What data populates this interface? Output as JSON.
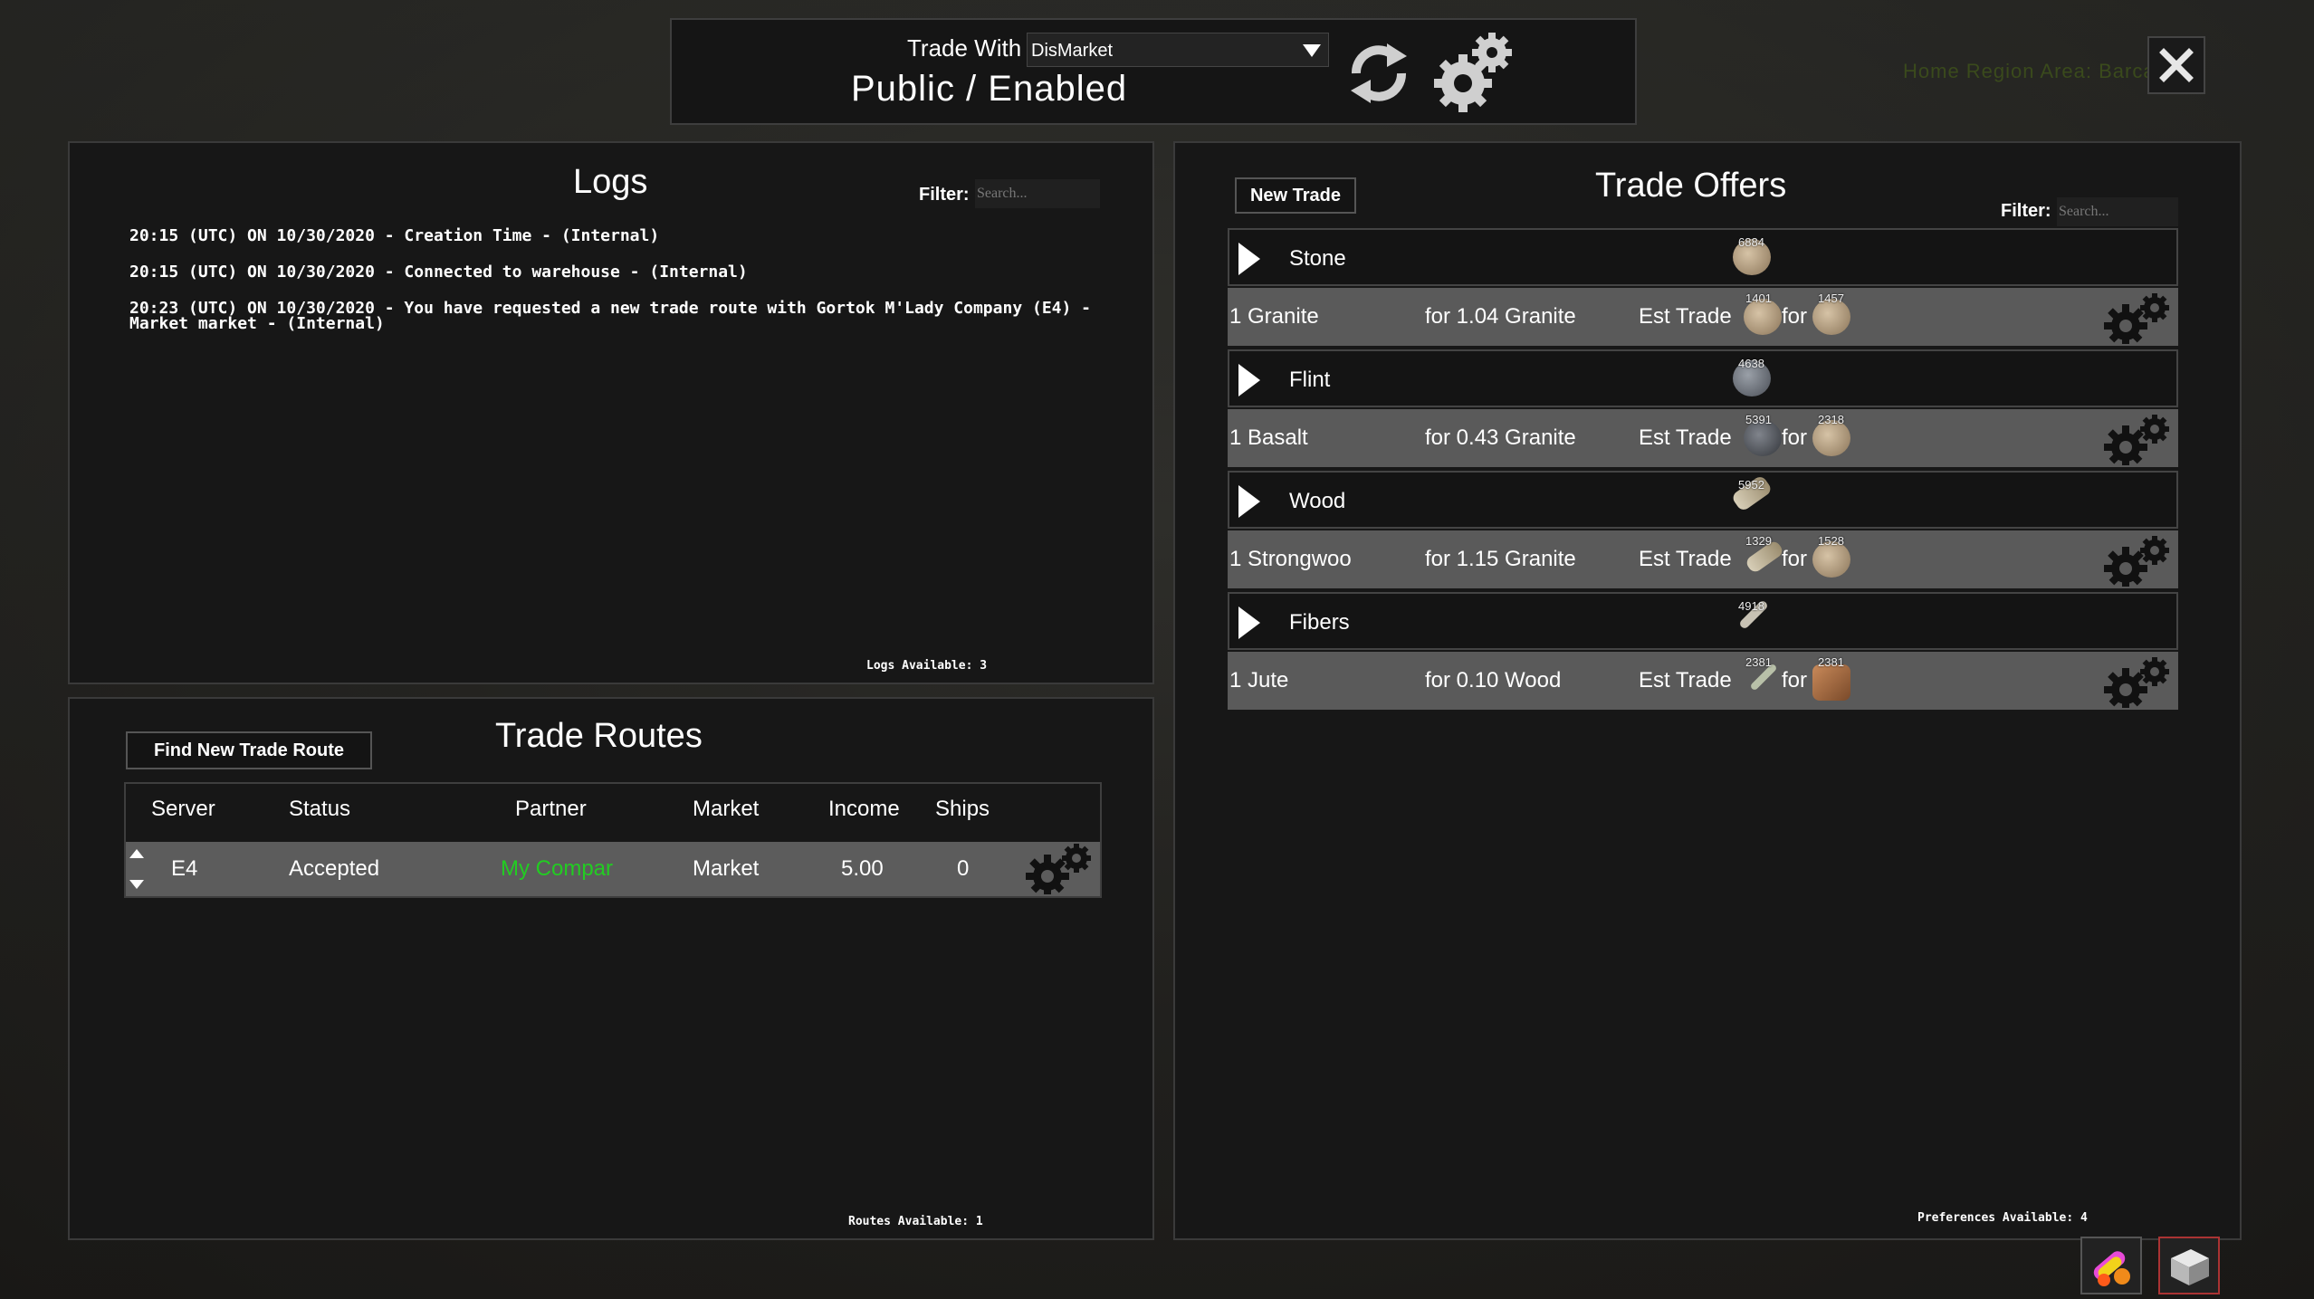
{
  "background": {
    "hud_text": "Home  Region  Area: Barca"
  },
  "topbar": {
    "trade_with_label": "Trade With",
    "trade_with_value": "DisMarket",
    "status": "Public / Enabled",
    "icons": [
      "refresh-icon",
      "gear-icon"
    ]
  },
  "close_icon": "close-icon",
  "logs": {
    "title": "Logs",
    "filter_label": "Filter:",
    "filter_placeholder": "Search...",
    "lines": [
      "20:15 (UTC) ON 10/30/2020 - Creation Time - (Internal)",
      "20:15 (UTC) ON 10/30/2020 - Connected to warehouse - (Internal)",
      "20:23 (UTC) ON 10/30/2020 - You have requested a new trade route with Gortok M'Lady Company (E4) - Market market - (Internal)"
    ],
    "available_label": "Logs Available:",
    "available_count": "3"
  },
  "trade_routes": {
    "title": "Trade Routes",
    "find_button": "Find New Trade Route",
    "headers": [
      "Server",
      "Status",
      "Partner",
      "Market",
      "Income",
      "Ships"
    ],
    "rows": [
      {
        "server": "E4",
        "status": "Accepted",
        "partner": "My Compar",
        "market": "Market",
        "income": "5.00",
        "ships": "0"
      }
    ],
    "available_label": "Routes Available:",
    "available_count": "1",
    "partner_color": "#22cc22"
  },
  "trade_offers": {
    "title": "Trade Offers",
    "new_trade_button": "New Trade",
    "filter_label": "Filter:",
    "filter_placeholder": "Search...",
    "groups": [
      {
        "category": "Stone",
        "category_count": "6884",
        "item": "1 Granite",
        "rate": "for 1.04 Granite",
        "est_label": "Est Trade",
        "for_label": "for",
        "give_count": "1401",
        "get_count": "1457"
      },
      {
        "category": "Flint",
        "category_count": "4638",
        "item": "1 Basalt",
        "rate": "for 0.43 Granite",
        "est_label": "Est Trade",
        "for_label": "for",
        "give_count": "5391",
        "get_count": "2318"
      },
      {
        "category": "Wood",
        "category_count": "5952",
        "item": "1 Strongwoo",
        "rate": "for 1.15 Granite",
        "est_label": "Est Trade",
        "for_label": "for",
        "give_count": "1329",
        "get_count": "1528"
      },
      {
        "category": "Fibers",
        "category_count": "4918",
        "item": "1 Jute",
        "rate": "for 0.10 Wood",
        "est_label": "Est Trade",
        "for_label": "for",
        "give_count": "2381",
        "get_count": "2381"
      }
    ],
    "available_label": "Preferences Available:",
    "available_count": "4"
  },
  "dock": {
    "icons": [
      "pills-icon",
      "crate-icon"
    ]
  }
}
